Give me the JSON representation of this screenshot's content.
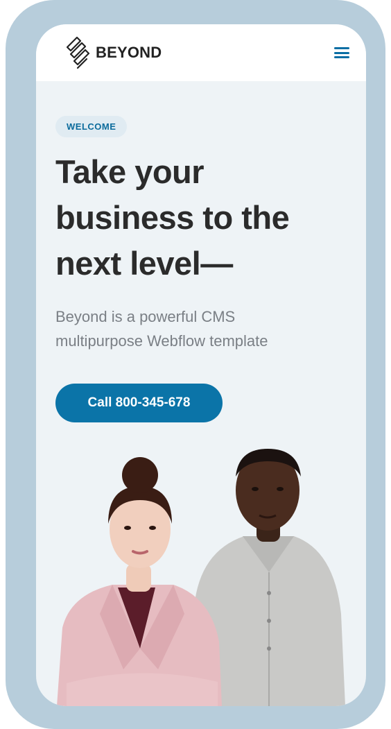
{
  "brand": {
    "name": "BEYOND",
    "logo_icon": "beyond-stripes-logo"
  },
  "nav": {
    "menu_icon": "hamburger-menu-icon"
  },
  "hero": {
    "badge": "WELCOME",
    "headline_lines": [
      "Take your",
      "business to the",
      "next level—"
    ],
    "subtext_lines": [
      "Beyond is a powerful CMS",
      "multipurpose Webflow template"
    ],
    "cta_label": "Call 800-345-678"
  },
  "colors": {
    "frame": "#b7cddb",
    "screen_bg": "#eef3f6",
    "accent": "#0b74a8",
    "badge_bg": "#e0ebf2",
    "headline": "#2b2b2b",
    "subtext": "#7a7f85"
  }
}
